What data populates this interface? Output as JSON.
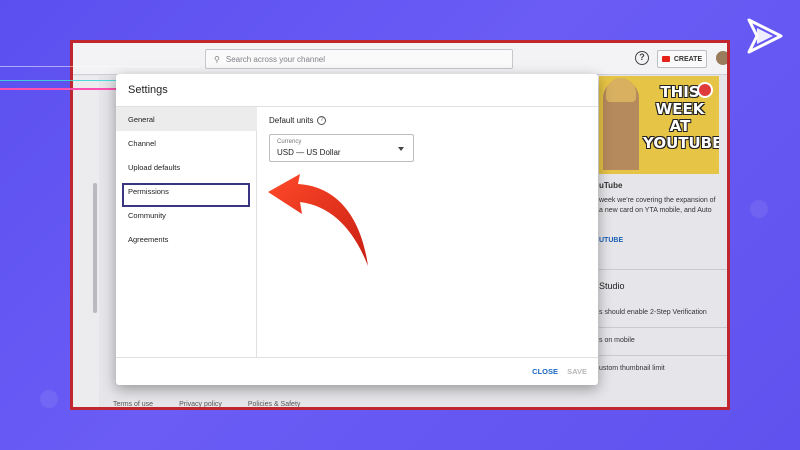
{
  "studio": {
    "search_placeholder": "Search across your channel",
    "create_label": "CREATE",
    "thumbnail_text": "THIS WEEK AT YOUTUBE",
    "news_title": "uTube",
    "news_line1": "week we're covering the expansion of",
    "news_line2": "a new card on YTA mobile, and Auto",
    "news_link": "UTUBE",
    "section_title": "Studio",
    "items": [
      "s should enable 2-Step Verification",
      "s on mobile",
      "ustom thumbnail limit"
    ],
    "footer": [
      "Terms of use",
      "Privacy policy",
      "Policies & Safety"
    ]
  },
  "dialog": {
    "title": "Settings",
    "nav": [
      {
        "label": "General"
      },
      {
        "label": "Channel"
      },
      {
        "label": "Upload defaults"
      },
      {
        "label": "Permissions"
      },
      {
        "label": "Community"
      },
      {
        "label": "Agreements"
      }
    ],
    "active_nav": "General",
    "highlighted_nav": "Permissions",
    "default_units_label": "Default units",
    "currency_caption": "Currency",
    "currency_value": "USD — US Dollar",
    "close_label": "CLOSE",
    "save_label": "SAVE"
  },
  "colors": {
    "background": "#5b4ff0",
    "frame": "#c0262e",
    "arrow": "#e4321f",
    "highlight": "#3a3580",
    "link": "#1a66c2"
  }
}
